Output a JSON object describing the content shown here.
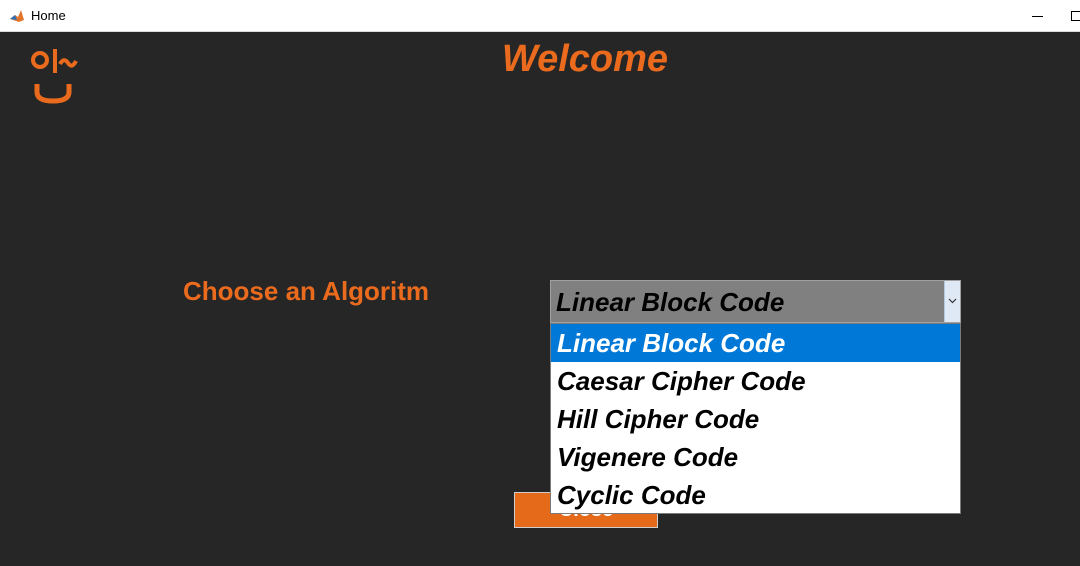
{
  "window": {
    "title": "Home"
  },
  "header": {
    "title": "Welcome"
  },
  "form": {
    "label": "Choose an Algoritm",
    "selected": "Linear Block Code",
    "options": [
      "Linear Block Code",
      "Caesar Cipher Code",
      "Hill Cipher Code",
      "Vigenere Code",
      "Cyclic Code"
    ],
    "highlighted_index": 0,
    "close_label": "Close"
  },
  "colors": {
    "accent": "#ea6b1d",
    "background": "#262626",
    "selection": "#0078d7"
  },
  "icons": {
    "app": "matlab-icon",
    "logo": "smiley-logo-icon"
  }
}
